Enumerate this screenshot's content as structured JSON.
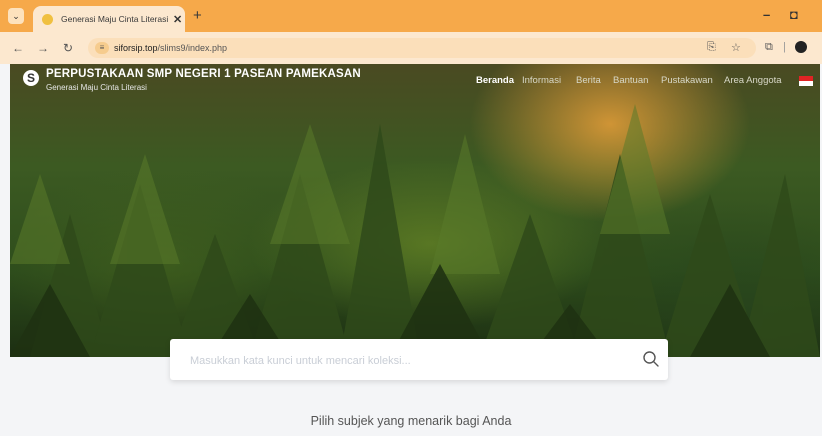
{
  "browser": {
    "tab_title": "Generasi Maju Cinta Literasi | P",
    "tab_close": "✕",
    "new_tab": "+",
    "url_domain": "siforsip.top",
    "url_path": "/slims9/index.php",
    "accent": "#f6a94a"
  },
  "site": {
    "name": "PERPUSTAKAAN SMP NEGERI 1 PASEAN PAMEKASAN",
    "tagline": "Generasi Maju Cinta Literasi",
    "logo_letter": "S",
    "nav": [
      {
        "label": "Beranda",
        "active": true
      },
      {
        "label": "Informasi"
      },
      {
        "label": "Berita"
      },
      {
        "label": "Bantuan"
      },
      {
        "label": "Pustakawan"
      },
      {
        "label": "Area Anggota"
      }
    ],
    "flag_colors": [
      "#e02424",
      "#ffffff"
    ]
  },
  "search": {
    "placeholder": "Masukkan kata kunci untuk mencari koleksi..."
  },
  "section": {
    "subtitle": "Pilih subjek yang menarik bagi Anda"
  }
}
